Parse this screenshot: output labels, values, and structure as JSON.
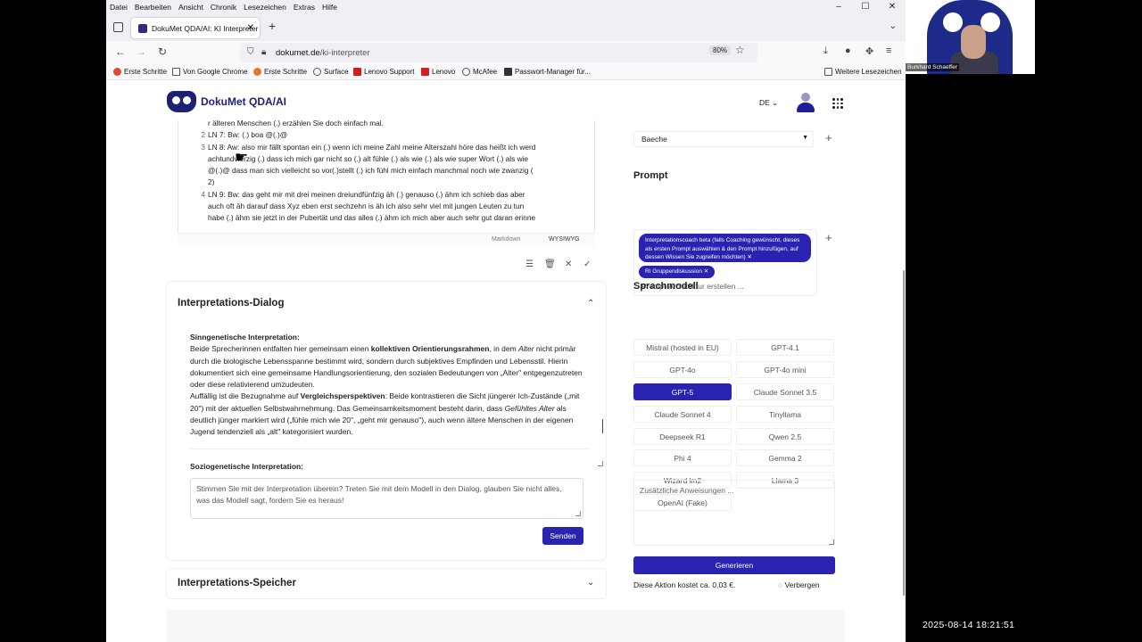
{
  "menubar": {
    "items": [
      "Datei",
      "Bearbeiten",
      "Ansicht",
      "Chronik",
      "Lesezeichen",
      "Extras",
      "Hilfe"
    ],
    "minimize": "–",
    "maximize": "☐",
    "close": "✕"
  },
  "tab": {
    "title": "DokuMet QDA/AI: KI Interpreter",
    "close": "✕",
    "new": "+"
  },
  "nav": {
    "url_host": "dokumet.de",
    "url_path": "/ki-interpreter",
    "zoom": "80%",
    "back": "←",
    "forward": "→",
    "reload": "↻",
    "star": "☆"
  },
  "bookmarks": [
    "Erste Schritte",
    "Von Google Chrome",
    "Erste Schritte",
    "Surface",
    "Lenovo Support",
    "Lenovo",
    "McAfee",
    "Passwort-Manager für...",
    "Weitere Lesezeichen"
  ],
  "app": {
    "brand": "DokuMet QDA/AI",
    "lang": "DE"
  },
  "transcript": {
    "lines": [
      {
        "num": "",
        "text": "r älteren Menschen (.) erzählen Sie doch einfach mal."
      },
      {
        "num": "2",
        "text": "LN 7:   Bw:      (.) boa @(.)@"
      },
      {
        "num": "3",
        "text": "LN 8:   Aw: also mir fällt spontan ein (.) wenn ich meine  Zahl meine Alterszahl höre das heißt ich werd"
      },
      {
        "num": "",
        "text": " achtundvierzig (.) dass ich mich gar nicht so (.) alt fühle (.) als wie (.) als wie super Wort (.) als wie"
      },
      {
        "num": "",
        "text": "@(.)@ dass man sich vielleicht so vor(.)stellt (.) ich fühl mich einfach manchmal noch wie zwanzig ("
      },
      {
        "num": "",
        "text": "2)"
      },
      {
        "num": "4",
        "text": "LN 9:   Bw:      das geht mir mit drei meinen dreiundfünfzig äh (.) genauso (.) ähm ich schieb das aber"
      },
      {
        "num": "",
        "text": "auch oft äh darauf dass Xyz eben erst sechzehn is äh ich also sehr viel mit jungen Leuten zu tun"
      },
      {
        "num": "",
        "text": "habe (.) ähm sie jetzt in der Pubertät und das alles (.) ähm ich mich aber auch sehr gut daran erinne"
      }
    ],
    "mode_markdown": "Markdown",
    "mode_wysiwyg": "WYSIWYG"
  },
  "dialog": {
    "title": "Interpretations-Dialog",
    "section1_title": "Sinngenetische Interpretation:",
    "p1_a": "Beide Sprecherinnen entfalten hier gemeinsam einen ",
    "p1_b": "kollektiven Orientierungsrahmen",
    "p1_c": ", in dem ",
    "p1_d": "Alter",
    "p1_e": " nicht primär durch die biologische Lebensspanne bestimmt wird, sondern durch subjektives Empfinden und Lebensstil. Hierin dokumentiert sich eine gemeinsame Handlungsorientierung, den sozialen Bedeutungen von „Alter\" entgegenzutreten oder diese relativierend umzudeuten.",
    "p2_a": "Auffällig ist die Bezugnahme auf ",
    "p2_b": "Vergleichsperspektiven",
    "p2_c": ": Beide kontrastieren die Sicht jüngerer Ich-Zustände („mit 20\") mit der aktuellen Selbstwahrnehmung. Das Gemeinsamkeitsmoment besteht darin, dass ",
    "p2_d": "Gefühltes Alter",
    "p2_e": " als deutlich jünger markiert wird („fühle mich wie 20\", „geht mir genauso\"), auch wenn ältere Menschen in der eigenen Jugend tendenziell als „alt\" kategorisiert wurden.",
    "section2_title": "Soziogenetische Interpretation:",
    "reply_placeholder": "Stimmen Sie mit der Interpretation überein? Treten Sie mit dem Modell in den Dialog, glauben Sie nicht alles, was das Modell sagt, fordern Sie es heraus!",
    "send": "Senden"
  },
  "memory": {
    "title": "Interpretations-Speicher"
  },
  "sidebar": {
    "select_value": "Baeche",
    "prompt_title": "Prompt",
    "chip1": "Interpretationscoach beta (falls Coaching gewünscht, dieses als ersten Prompt auswählen & den Prompt hinzufügen, auf dessen Wissen Sie zugreifen möchten)",
    "chip2": "RI Gruppendiskussion",
    "prompt_placeholder": "Prompt-Architektur erstellen ...",
    "model_title": "Sprachmodell",
    "models": [
      "Mistral (hosted in EU)",
      "GPT-4.1",
      "GPT-4o",
      "GPT-4o mini",
      "GPT-5",
      "Claude Sonnet 3.5",
      "Claude Sonnet 4",
      "Tinyllama",
      "Deepseek R1",
      "Qwen 2.5",
      "Phi 4",
      "Gemma 2",
      "Wizard lm2",
      "Llama 3",
      "OpenAI (Fake)"
    ],
    "active_model": "GPT-5",
    "extra_placeholder": "Zusätzliche Anweisungen ...",
    "generate": "Generieren",
    "cost": "Diese Aktion kostet ca. 0,03 €.",
    "hide": "Verbergen"
  },
  "overlay": {
    "webcam_name": "Burkhard Schaeffer",
    "timestamp": "2025-08-14 18:21:51"
  },
  "colors": {
    "accent": "#2a22b0",
    "brand": "#1e2073"
  }
}
